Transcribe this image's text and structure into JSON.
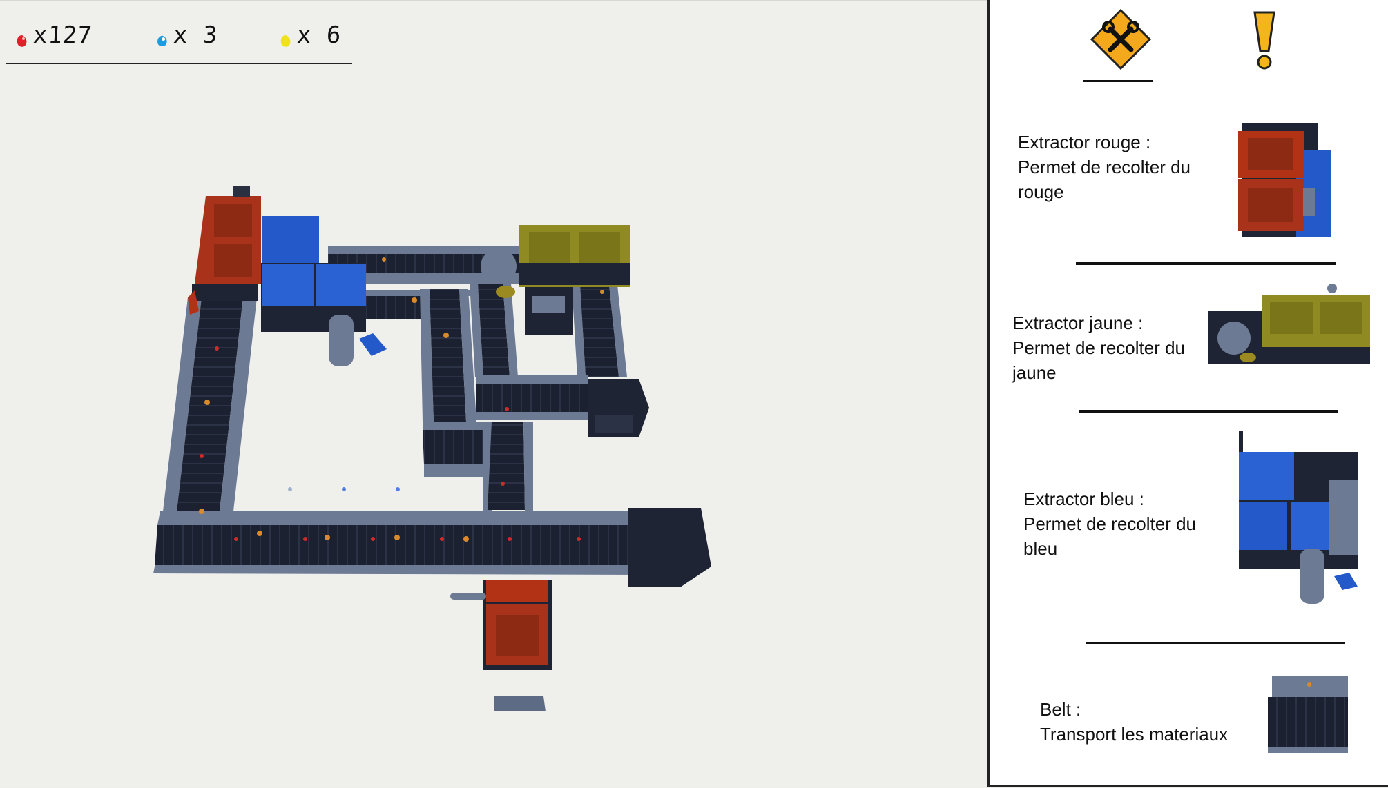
{
  "hud": {
    "resources": [
      {
        "name": "red",
        "count_label": "x127",
        "color": "#e0212a"
      },
      {
        "name": "blue",
        "count_label": "x 3",
        "color": "#1d9be0"
      },
      {
        "name": "yellow",
        "count_label": "x 6",
        "color": "#f0e21a"
      }
    ]
  },
  "panel": {
    "tabs": [
      {
        "name": "build",
        "icon": "tools-icon",
        "color": "#f4a91c"
      },
      {
        "name": "alerts",
        "icon": "exclamation-icon",
        "color": "#f4b41c"
      }
    ],
    "cards": [
      {
        "title": "Extractor rouge :",
        "desc_line1": "Permet de recolter du",
        "desc_line2": "rouge",
        "accent": "#b23216"
      },
      {
        "title": "Extractor jaune :",
        "desc_line1": "Permet de recolter du",
        "desc_line2": "jaune",
        "accent": "#8a8522"
      },
      {
        "title": "Extractor bleu :",
        "desc_line1": "Permet de recolter du",
        "desc_line2": "bleu",
        "accent": "#2459c8"
      },
      {
        "title": "Belt :",
        "desc_line1": "Transport les materiaux",
        "desc_line2": "",
        "accent": "#1c2230"
      }
    ]
  },
  "colors": {
    "belt_dark": "#1b2130",
    "belt_frame": "#5e6b85",
    "red_block": "#a9321a",
    "blue_block": "#2359c9",
    "yellow_block": "#8f8a22",
    "machine_dark": "#1e2433"
  }
}
